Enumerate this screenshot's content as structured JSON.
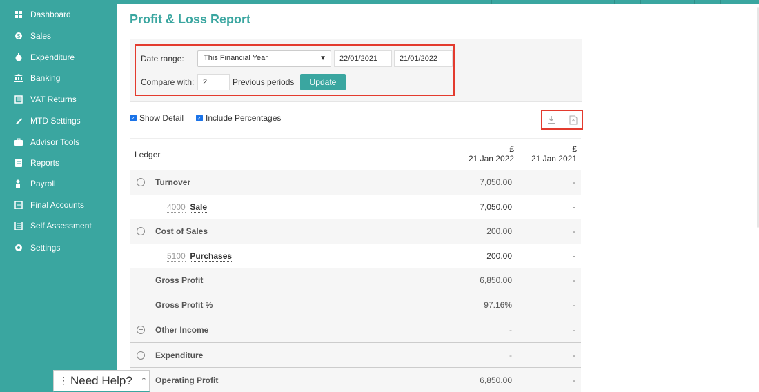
{
  "sidebar": {
    "items": [
      {
        "label": "Dashboard",
        "icon": "dashboard-icon"
      },
      {
        "label": "Sales",
        "icon": "sales-icon"
      },
      {
        "label": "Expenditure",
        "icon": "expenditure-icon"
      },
      {
        "label": "Banking",
        "icon": "bank-icon"
      },
      {
        "label": "VAT Returns",
        "icon": "vat-icon"
      },
      {
        "label": "MTD Settings",
        "icon": "mtd-icon"
      },
      {
        "label": "Advisor Tools",
        "icon": "briefcase-icon"
      },
      {
        "label": "Reports",
        "icon": "reports-icon"
      },
      {
        "label": "Payroll",
        "icon": "payroll-icon"
      },
      {
        "label": "Final Accounts",
        "icon": "final-accounts-icon"
      },
      {
        "label": "Self Assessment",
        "icon": "self-assessment-icon"
      },
      {
        "label": "Settings",
        "icon": "gear-icon"
      }
    ]
  },
  "page": {
    "title": "Profit & Loss Report"
  },
  "filters": {
    "date_range_label": "Date range:",
    "date_range_value": "This Financial Year",
    "date_from": "22/01/2021",
    "date_to": "21/01/2022",
    "compare_label": "Compare with:",
    "compare_value": "2",
    "previous_periods_label": "Previous periods",
    "update_label": "Update"
  },
  "options": {
    "show_detail": "Show Detail",
    "include_percentages": "Include Percentages"
  },
  "table": {
    "header": {
      "ledger": "Ledger",
      "col1_currency": "£",
      "col1_date": "21 Jan 2022",
      "col2_currency": "£",
      "col2_date": "21 Jan 2021"
    },
    "rows": [
      {
        "label": "Turnover",
        "v1": "7,050.00",
        "v2": "-"
      },
      {
        "code": "4000",
        "label": "Sale",
        "v1": "7,050.00",
        "v2": "-"
      },
      {
        "label": "Cost of Sales",
        "v1": "200.00",
        "v2": "-"
      },
      {
        "code": "5100",
        "label": "Purchases",
        "v1": "200.00",
        "v2": "-"
      },
      {
        "label": "Gross Profit",
        "v1": "6,850.00",
        "v2": "-"
      },
      {
        "label": "Gross Profit %",
        "v1": "97.16%",
        "v2": "-"
      },
      {
        "label": "Other Income",
        "v1": "-",
        "v2": "-"
      },
      {
        "label": "Expenditure",
        "v1": "-",
        "v2": "-"
      },
      {
        "label": "Operating Profit",
        "v1": "6,850.00",
        "v2": "-"
      }
    ]
  },
  "help": {
    "label": "Need Help?"
  },
  "colors": {
    "accent": "#3aa6a0",
    "highlight": "#e33b2e"
  }
}
